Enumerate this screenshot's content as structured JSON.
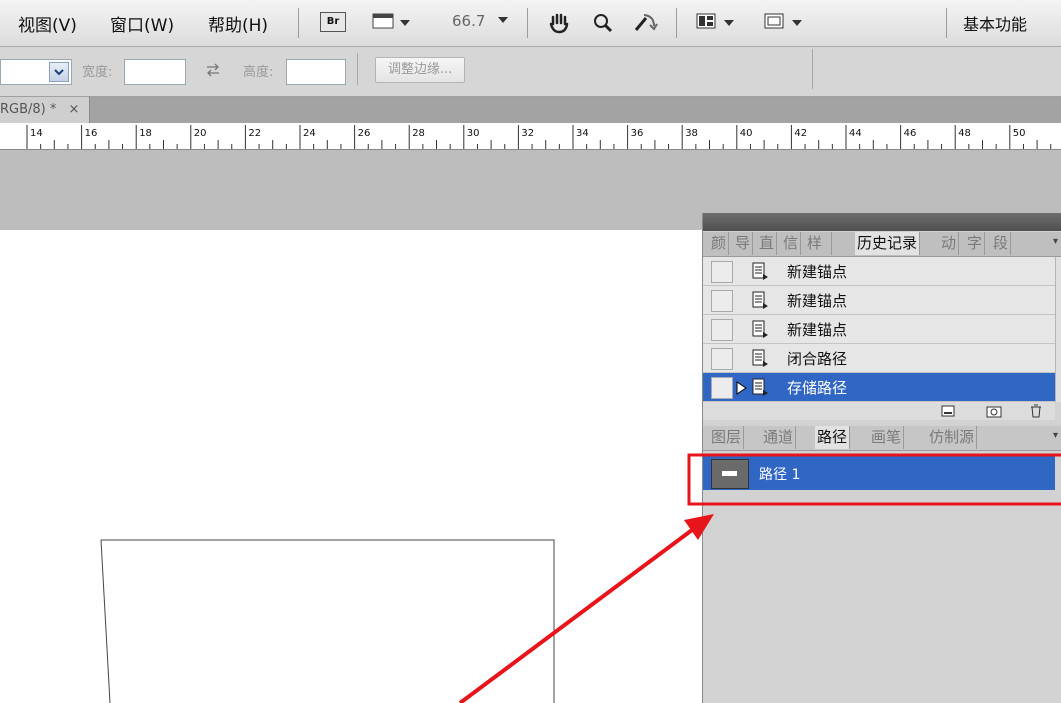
{
  "menubar": {
    "items": [
      "视图(V)",
      "窗口(W)",
      "帮助(H)"
    ],
    "zoom": "66.7",
    "workspace": "基本功能",
    "br_label": "Br"
  },
  "options": {
    "width_label": "宽度:",
    "height_label": "高度:",
    "refine_button": "调整边缘..."
  },
  "document": {
    "tab_label": "RGB/8) *",
    "close": "×"
  },
  "ruler": {
    "ticks": [
      "14",
      "16",
      "18",
      "20",
      "22",
      "24",
      "26",
      "28",
      "30",
      "32",
      "34",
      "36",
      "38",
      "40",
      "42",
      "44",
      "46",
      "48",
      "50"
    ]
  },
  "history_panel": {
    "tabs": [
      "颜",
      "导",
      "直",
      "信",
      "样",
      "历史记录",
      "动",
      "字",
      "段"
    ],
    "active_tab": "历史记录",
    "items": [
      "新建锚点",
      "新建锚点",
      "新建锚点",
      "闭合路径",
      "存储路径"
    ],
    "selected_index": 4
  },
  "paths_panel": {
    "tabs": [
      "图层",
      "通道",
      "路径",
      "画笔",
      "仿制源"
    ],
    "active_tab": "路径",
    "items": [
      "路径 1"
    ]
  },
  "colors": {
    "selection": "#3167c4",
    "annotation": "#e8141c"
  }
}
